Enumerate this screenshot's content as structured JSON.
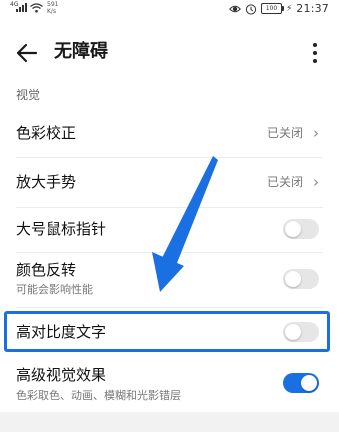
{
  "status_bar": {
    "network": "4G",
    "speed_value": "591",
    "speed_unit": "K/s",
    "battery": "100",
    "time": "21:37"
  },
  "app_bar": {
    "title": "无障碍"
  },
  "section": {
    "title": "视觉"
  },
  "items": [
    {
      "label": "色彩校正",
      "status": "已关闭"
    },
    {
      "label": "放大手势",
      "status": "已关闭"
    },
    {
      "label": "大号鼠标指针",
      "toggle_on": false
    },
    {
      "label": "颜色反转",
      "subtitle": "可能会影响性能",
      "toggle_on": false
    },
    {
      "label": "高对比度文字",
      "toggle_on": false
    },
    {
      "label": "高级视觉效果",
      "subtitle": "色彩取色、动画、模糊和光影错层",
      "toggle_on": true
    }
  ],
  "colors": {
    "accent": "#1a6fe3",
    "annotation": "#1a6fe3",
    "toggle_off": "#e6e6e6"
  },
  "icons": {
    "back": "arrow-left-icon",
    "more": "more-vertical-icon",
    "chevron": "chevron-right-icon",
    "eye": "eye-icon",
    "alarm": "alarm-icon"
  }
}
